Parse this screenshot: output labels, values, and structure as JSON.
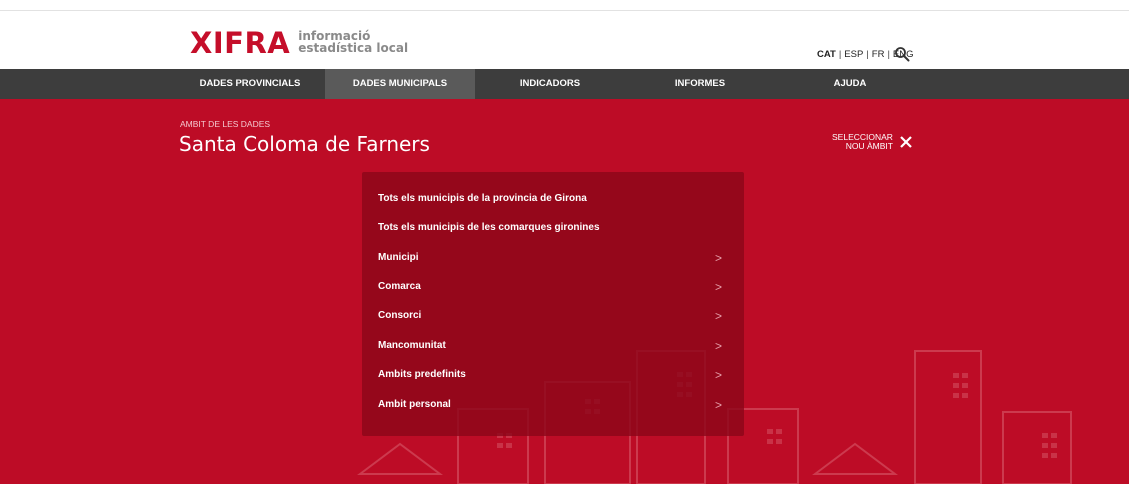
{
  "header": {
    "logo_word": "XIFRA",
    "logo_line1": "informació",
    "logo_line2": "estadística local",
    "languages": [
      "CAT",
      "ESP",
      "FR",
      "ENG"
    ],
    "search_icon": "search-icon"
  },
  "nav": {
    "items": [
      {
        "label": "DADES PROVINCIALS"
      },
      {
        "label": "DADES MUNICIPALS"
      },
      {
        "label": "INDICADORS"
      },
      {
        "label": "INFORMES"
      },
      {
        "label": "AJUDA"
      }
    ],
    "active": "DADES MUNICIPALS"
  },
  "hero": {
    "label": "AMBIT DE LES DADES",
    "title": "Santa Coloma de Farners",
    "select_line1": "SELECCIONAR",
    "select_line2": "NOU ÀMBIT",
    "close_icon": "close-icon"
  },
  "menu": {
    "items": [
      {
        "label": "Tots els municipis de la provincia de Girona",
        "chevron": ""
      },
      {
        "label": "Tots els municipis de les comarques gironines",
        "chevron": ""
      },
      {
        "label": "Municipi",
        "chevron": ">"
      },
      {
        "label": "Comarca",
        "chevron": ">"
      },
      {
        "label": "Consorci",
        "chevron": ">"
      },
      {
        "label": "Mancomunitat",
        "chevron": ">"
      },
      {
        "label": "Ambits predefinits",
        "chevron": ">"
      },
      {
        "label": "Ambit personal",
        "chevron": ">"
      }
    ]
  },
  "colors": {
    "brand_red": "#c50e2a",
    "hero_red": "#bd0c26",
    "nav_dark": "#3d3d3d",
    "panel": "#8c061a"
  }
}
